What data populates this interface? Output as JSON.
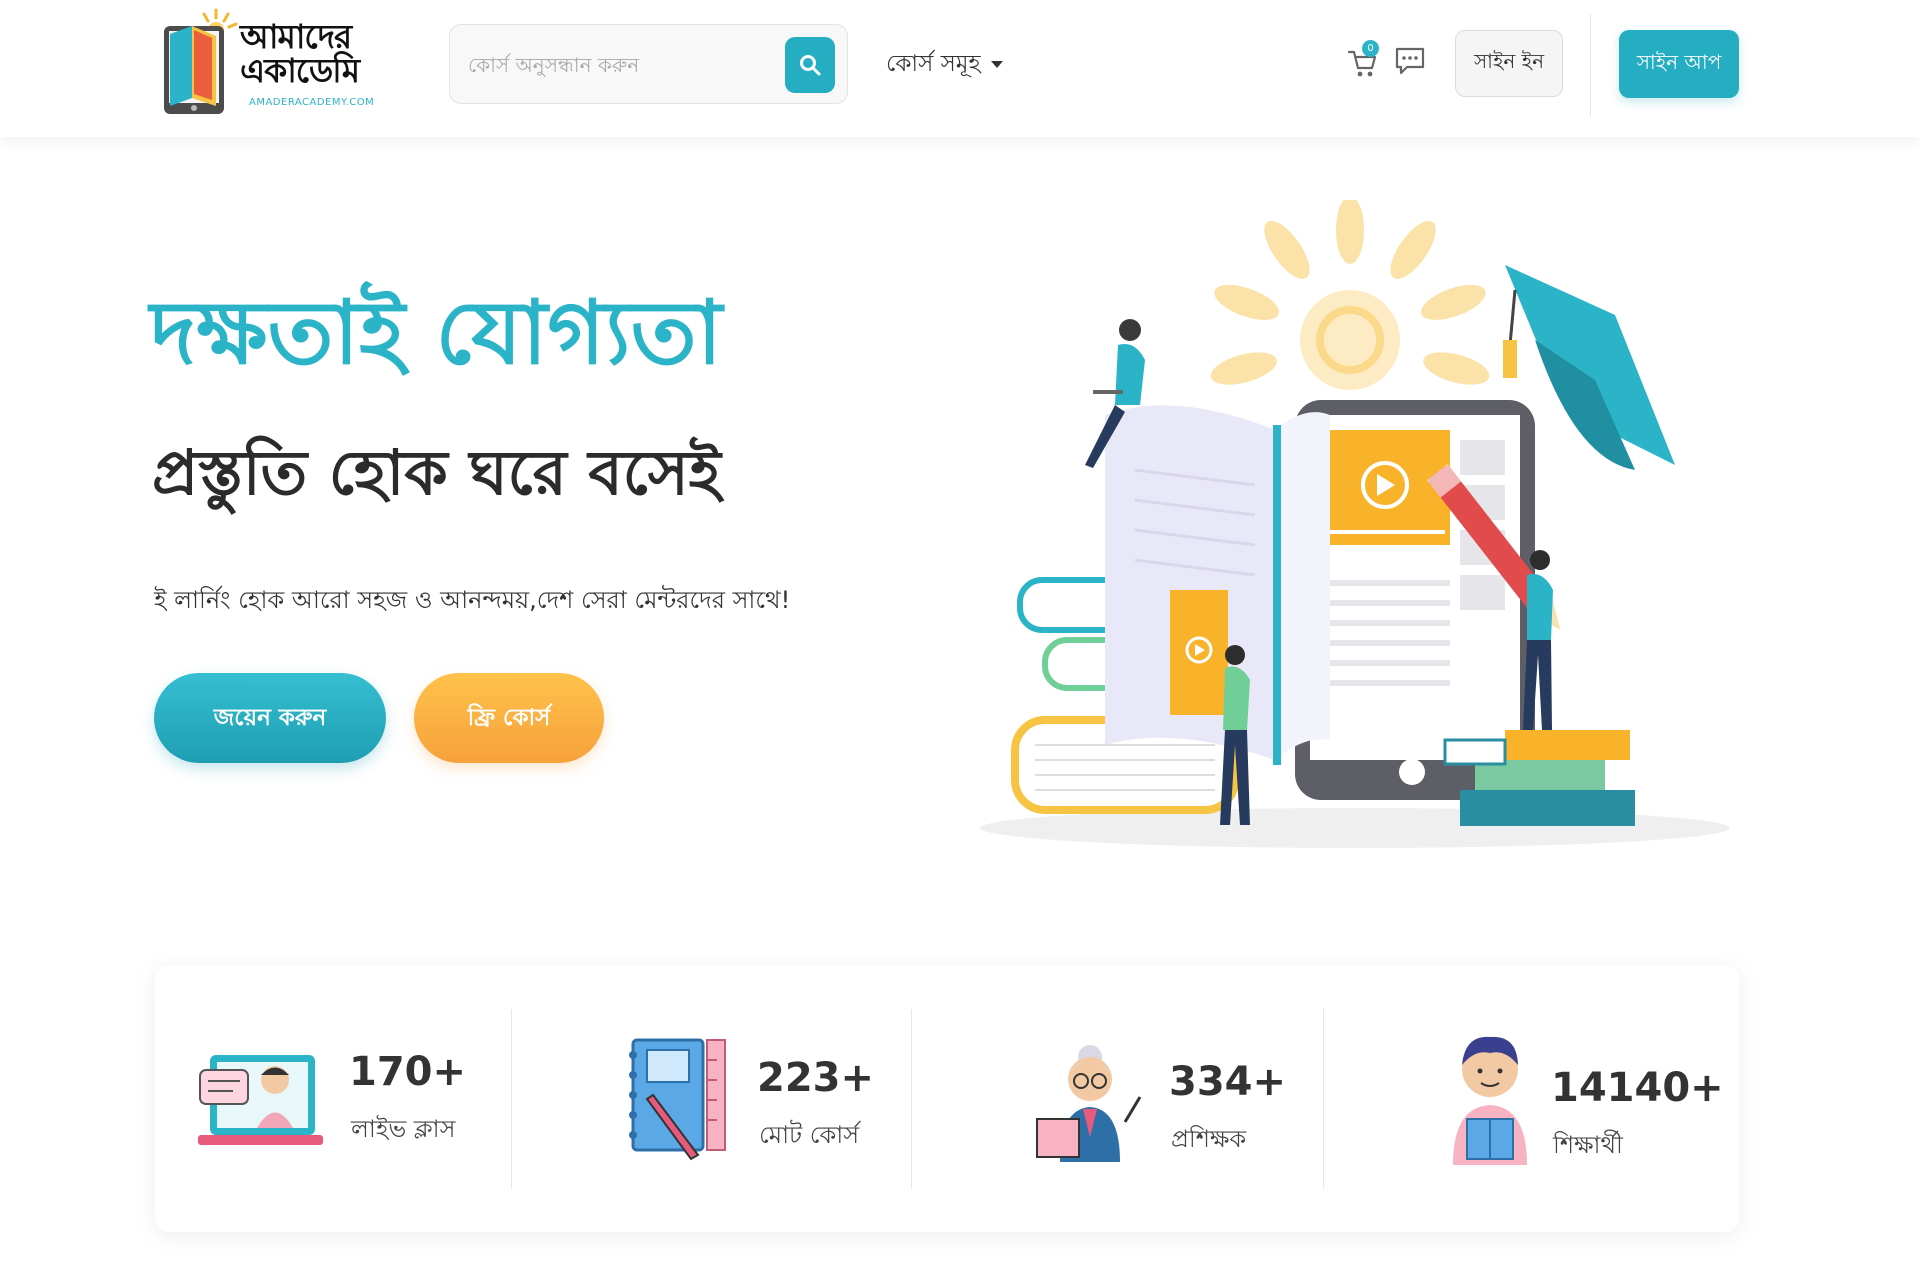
{
  "header": {
    "logo": {
      "title": "আমাদের একাডেমি",
      "subtitle": "AMADERACADEMY.COM"
    },
    "search": {
      "placeholder": "কোর্স অনুসন্ধান করুন"
    },
    "courses_dropdown": "কোর্স সমূহ",
    "cart_count": "0",
    "signin_label": "সাইন ইন",
    "signup_label": "সাইন আপ"
  },
  "hero": {
    "title": "দক্ষতাই যোগ্যতা",
    "subtitle": "প্রস্তুতি হোক ঘরে বসেই",
    "description": "ই লার্নিং হোক আরো সহজ ও আনন্দময়,দেশ সেরা মেন্টরদের সাথে!",
    "join_button": "জয়েন করুন",
    "free_course_button": "ফ্রি কোর্স"
  },
  "stats": [
    {
      "value": "170+",
      "label": "লাইভ ক্লাস",
      "icon": "live-class-icon"
    },
    {
      "value": "223+",
      "label": "মোট কোর্স",
      "icon": "notebook-icon"
    },
    {
      "value": "334+",
      "label": "প্রশিক্ষক",
      "icon": "instructor-icon"
    },
    {
      "value": "14140+",
      "label": "শিক্ষার্থী",
      "icon": "student-icon"
    }
  ],
  "colors": {
    "primary": "#25adc1",
    "accent": "#f6a13b",
    "heading_dark": "#2b2b2b"
  }
}
